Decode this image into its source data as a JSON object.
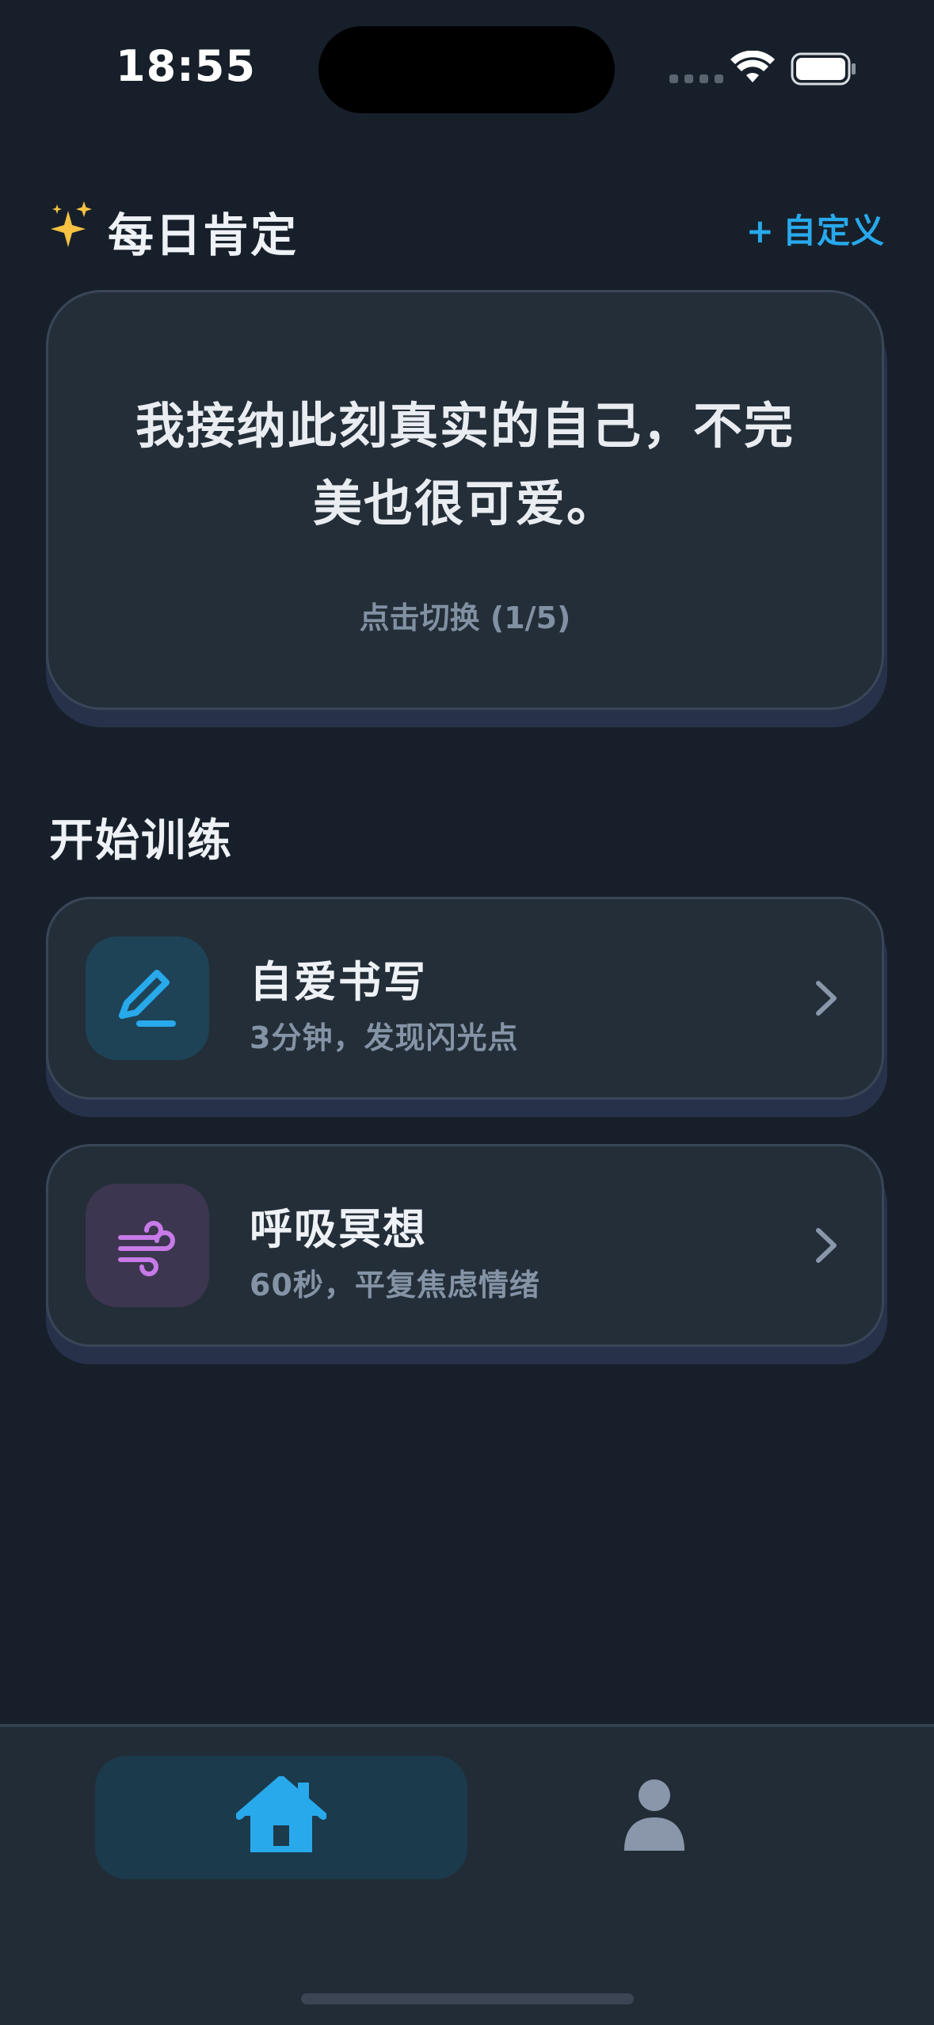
{
  "status_bar": {
    "time": "18:55"
  },
  "affirmation": {
    "title": "每日肯定",
    "customize_label": "自定义",
    "customize_plus": "+",
    "text": "我接纳此刻真实的自己，不完美也很可爱。",
    "hint": "点击切换 (1/5)",
    "icon": "sparkles-icon"
  },
  "training": {
    "section_title": "开始训练",
    "items": [
      {
        "title": "自爱书写",
        "subtitle": "3分钟，发现闪光点",
        "icon": "pencil-icon",
        "icon_color": "#28a9ec",
        "icon_bg": "#1e4356"
      },
      {
        "title": "呼吸冥想",
        "subtitle": "60秒，平复焦虑情绪",
        "icon": "wind-icon",
        "icon_color": "#c77ae8",
        "icon_bg": "#3d3650"
      }
    ]
  },
  "tab_bar": {
    "tabs": [
      {
        "name": "home",
        "icon": "home-icon",
        "active": true,
        "color": "#28a9ec"
      },
      {
        "name": "profile",
        "icon": "person-icon",
        "active": false,
        "color": "#8a97ab"
      }
    ]
  },
  "colors": {
    "background": "#17202a",
    "card": "#232e38",
    "accent": "#28a9ec"
  }
}
